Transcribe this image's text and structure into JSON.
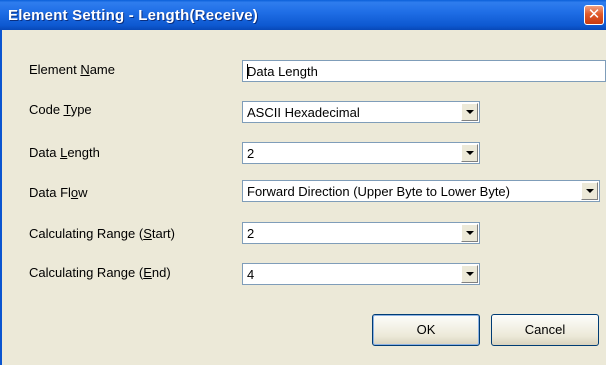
{
  "window": {
    "title": "Element Setting - Length(Receive)",
    "close_glyph": "✕"
  },
  "fields": {
    "element_name": {
      "label_pre": "Element ",
      "label_key": "N",
      "label_post": "ame",
      "value": "Data Length"
    },
    "code_type": {
      "label_pre": "Code ",
      "label_key": "T",
      "label_post": "ype",
      "value": "ASCII Hexadecimal"
    },
    "data_length": {
      "label_pre": "Data ",
      "label_key": "L",
      "label_post": "ength",
      "value": "2"
    },
    "data_flow": {
      "label_pre": "Data Fl",
      "label_key": "o",
      "label_post": "w",
      "value": "Forward Direction (Upper Byte to Lower Byte)"
    },
    "calc_start": {
      "label_pre": "Calculating Range (",
      "label_key": "S",
      "label_post": "tart)",
      "value": "2"
    },
    "calc_end": {
      "label_pre": "Calculating Range (",
      "label_key": "E",
      "label_post": "nd)",
      "value": "4"
    }
  },
  "buttons": {
    "ok": "OK",
    "cancel": "Cancel"
  },
  "colors": {
    "titlebar": "#0d58d0",
    "dialog_bg": "#ece9d8",
    "field_border": "#7f9db9",
    "close_button": "#e05a2a"
  }
}
